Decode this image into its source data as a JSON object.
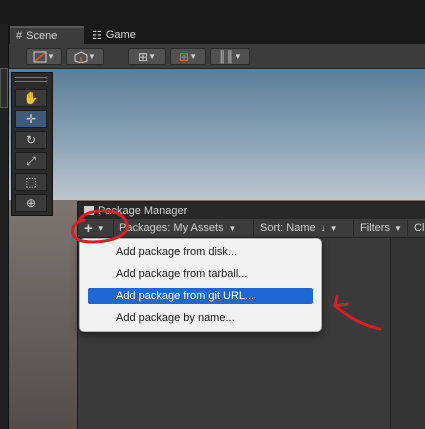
{
  "tabs": [
    {
      "icon": "grid-icon",
      "label": "Scene"
    },
    {
      "icon": "gamepad-icon",
      "label": "Game"
    }
  ],
  "package_manager": {
    "title": "Package Manager",
    "add_button": "+",
    "packages_dropdown": "Packages: My Assets",
    "sort_dropdown": "Sort: Name",
    "filters_dropdown": "Filters",
    "clear_button": "Cl"
  },
  "add_menu": {
    "items": [
      "Add package from disk...",
      "Add package from tarball...",
      "Add package from git URL...",
      "Add package by name..."
    ],
    "highlighted_index": 2
  },
  "annotations": {
    "circle_color": "#d81f26",
    "arrow_color": "#d81f26"
  },
  "colors": {
    "highlight": "#1f67d6",
    "selected_tool": "#3d5a7a"
  }
}
